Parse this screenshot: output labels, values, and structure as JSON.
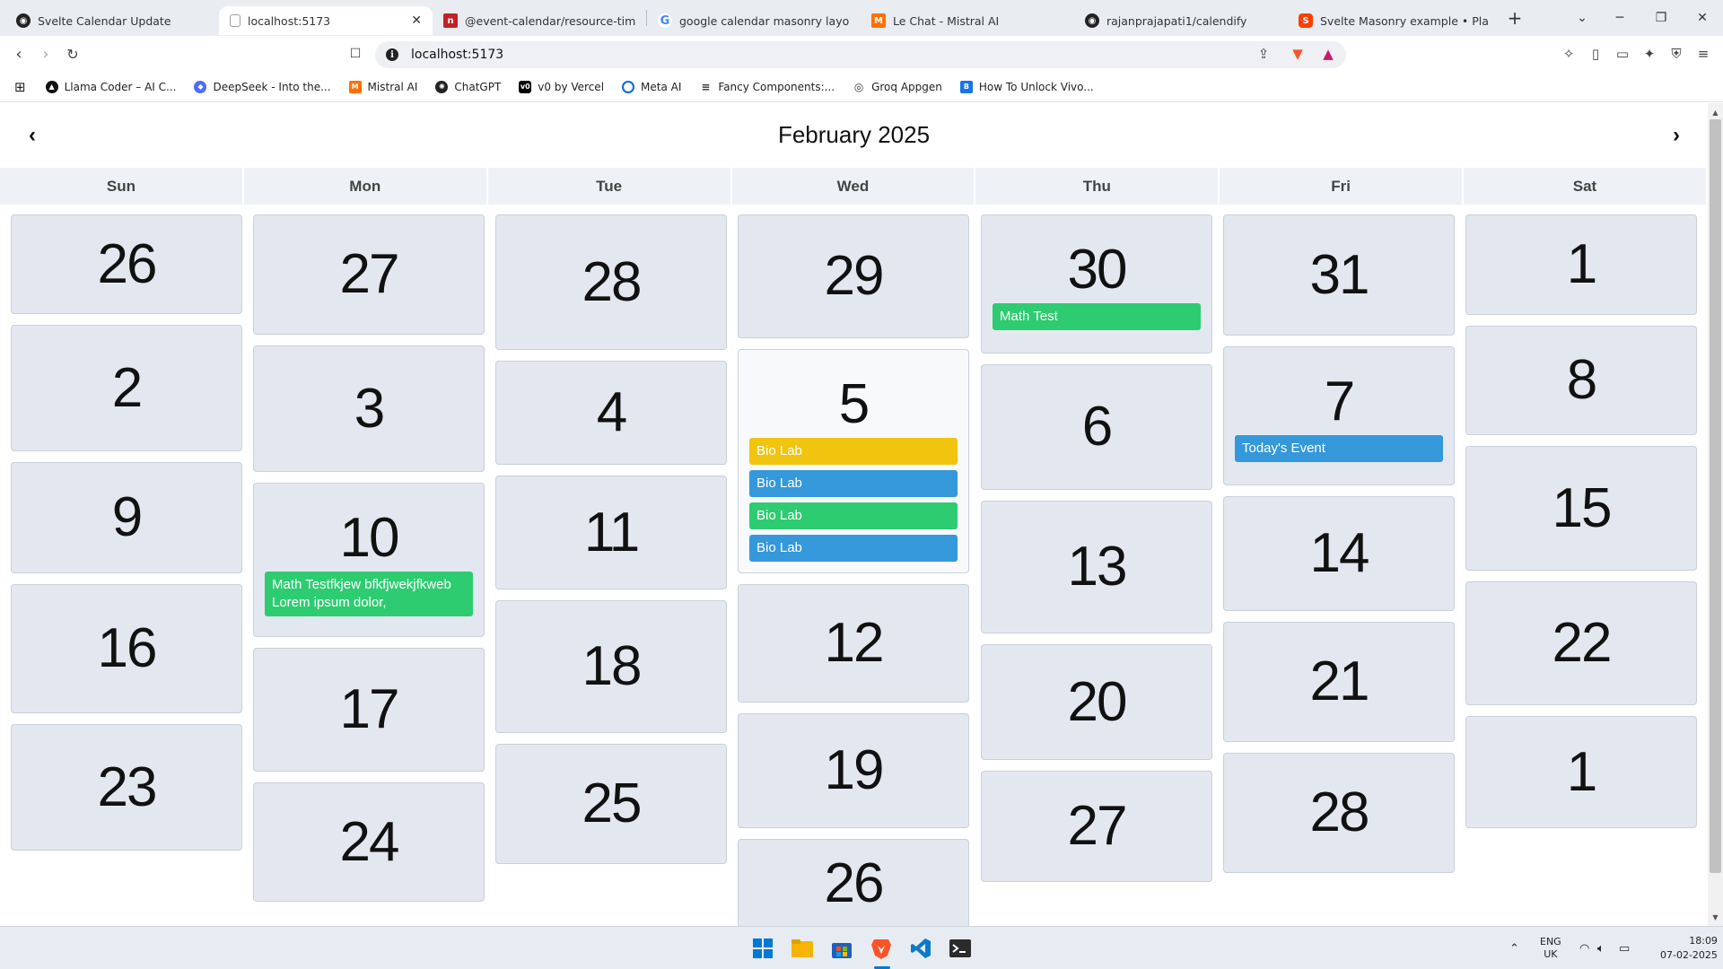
{
  "browser": {
    "tabs": [
      {
        "title": "Svelte Calendar Update",
        "icon": "github-circle-icon",
        "color": "#222222"
      },
      {
        "title": "localhost:5173",
        "icon": "page-icon",
        "color": "#9aa0a6",
        "active": true
      },
      {
        "title": "@event-calendar/resource-time-gri",
        "icon": "npm-icon",
        "color": "#c12127"
      },
      {
        "title": "google calendar masonry layout - G",
        "icon": "google-icon",
        "color": "#4285f4"
      },
      {
        "title": "Le Chat - Mistral AI",
        "icon": "mistral-icon",
        "color": "#ff7000"
      },
      {
        "title": "rajanprajapati1/calendify",
        "icon": "github-icon",
        "color": "#222222"
      },
      {
        "title": "Svelte Masonry example • Playgrou",
        "icon": "svelte-icon",
        "color": "#ff3e00"
      }
    ],
    "url": "localhost:5173",
    "bookmarks": [
      {
        "label": "Llama Coder – AI C...",
        "color": "#111111"
      },
      {
        "label": "DeepSeek - Into the...",
        "color": "#4d6bfe"
      },
      {
        "label": "Mistral AI",
        "color": "#ff7000"
      },
      {
        "label": "ChatGPT",
        "color": "#222222"
      },
      {
        "label": "v0 by Vercel",
        "color": "#000000"
      },
      {
        "label": "Meta AI",
        "color": "#0668e1"
      },
      {
        "label": "Fancy Components:...",
        "color": "#333333"
      },
      {
        "label": "Groq Appgen",
        "color": "#333333"
      },
      {
        "label": "How To Unlock Vivo...",
        "color": "#1a73e8"
      }
    ]
  },
  "calendar": {
    "title": "February 2025",
    "weekdays": [
      "Sun",
      "Mon",
      "Tue",
      "Wed",
      "Thu",
      "Fri",
      "Sat"
    ],
    "columns": [
      [
        {
          "day": "26"
        },
        {
          "day": "2"
        },
        {
          "day": "9"
        },
        {
          "day": "16"
        },
        {
          "day": "23"
        }
      ],
      [
        {
          "day": "27"
        },
        {
          "day": "3"
        },
        {
          "day": "10",
          "events": [
            {
              "label": "Math Testfkjew bfkfjwekjfkweb Lorem ipsum dolor,",
              "color": "green"
            }
          ]
        },
        {
          "day": "17"
        },
        {
          "day": "24"
        }
      ],
      [
        {
          "day": "28"
        },
        {
          "day": "4"
        },
        {
          "day": "11"
        },
        {
          "day": "18"
        },
        {
          "day": "25"
        }
      ],
      [
        {
          "day": "29"
        },
        {
          "day": "5",
          "today": true,
          "events": [
            {
              "label": "Bio Lab",
              "color": "yellow"
            },
            {
              "label": "Bio Lab",
              "color": "blue"
            },
            {
              "label": "Bio Lab",
              "color": "green"
            },
            {
              "label": "Bio Lab",
              "color": "blue"
            }
          ]
        },
        {
          "day": "12"
        },
        {
          "day": "19"
        },
        {
          "day": "26"
        }
      ],
      [
        {
          "day": "30",
          "events": [
            {
              "label": "Math Test",
              "color": "green"
            }
          ]
        },
        {
          "day": "6"
        },
        {
          "day": "13"
        },
        {
          "day": "20"
        },
        {
          "day": "27"
        }
      ],
      [
        {
          "day": "31"
        },
        {
          "day": "7",
          "events": [
            {
              "label": "Today's Event",
              "color": "blue"
            }
          ]
        },
        {
          "day": "14"
        },
        {
          "day": "21"
        },
        {
          "day": "28"
        }
      ],
      [
        {
          "day": "1"
        },
        {
          "day": "8"
        },
        {
          "day": "15"
        },
        {
          "day": "22"
        },
        {
          "day": "1"
        }
      ]
    ],
    "colors": {
      "green": "#2ecc71",
      "yellow": "#f1c40f",
      "blue": "#3498db",
      "cell": "#e3e8f0",
      "weekday_bar": "#eef2f7"
    }
  },
  "taskbar": {
    "apps": [
      "windows-start-icon",
      "file-explorer-icon",
      "microsoft-store-icon",
      "brave-icon",
      "vscode-icon",
      "terminal-icon"
    ],
    "language": "ENG",
    "region": "UK",
    "time": "18:09",
    "date": "07-02-2025"
  }
}
